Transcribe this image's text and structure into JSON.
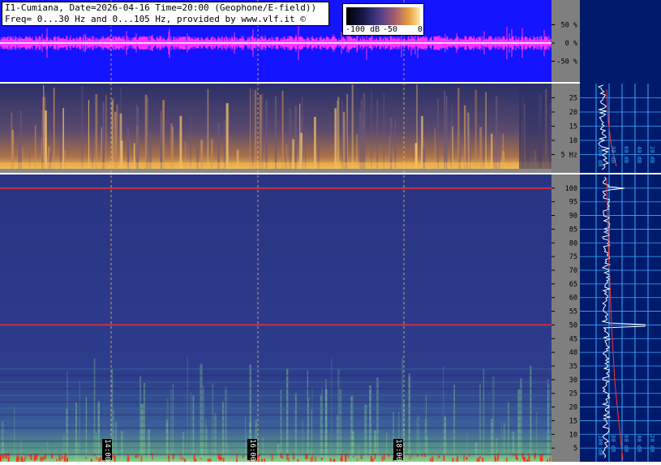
{
  "header": {
    "line1": "I1-Cumiana, Date=2026-04-16 Time=20:00 (Geophone/E-field))",
    "line2": "Freq= 0...30 Hz and 0...105 Hz, provided by www.vlf.it ©"
  },
  "colorbar": {
    "labels": [
      "-100 dB",
      "-50",
      "0"
    ],
    "colors": [
      "#000000",
      "#1a1a50",
      "#4a3f8a",
      "#a05a70",
      "#e9a040",
      "#ffe7a6"
    ]
  },
  "time_markers": [
    "14:00",
    "16:00",
    "18:00"
  ],
  "colors": {
    "waveform_bg": "#1414ff",
    "waveform_trace": "#ff33ff",
    "spec_low_bg": "#29306b",
    "spec_main_bg": "#2b3886",
    "axis_bg": "#7f7f7f",
    "side_bg": "#001a6c",
    "side_grid": "#3aa9ff",
    "power_line": "#ff2a2a",
    "trace_white": "#ffffff",
    "trace_red": "#ff3333"
  },
  "chart_data": [
    {
      "type": "line",
      "title": "",
      "description_key": "amplitude waveform",
      "ylabel_ticks": [
        "50 %",
        "0 %",
        "-50 %"
      ],
      "yticks": [
        50,
        0,
        -50
      ],
      "ylim": [
        -100,
        100
      ]
    },
    {
      "type": "heatmap",
      "ylabel_ticks": [
        "25",
        "20",
        "15",
        "10",
        "5 Hz"
      ],
      "yticks": [
        25,
        20,
        15,
        10,
        5
      ],
      "ylim": [
        0,
        30
      ],
      "x_ticks": [
        "14:00",
        "16:00",
        "18:00"
      ],
      "side_ticks": [
        "100 dB",
        "80 dB",
        "60 dB",
        "40 dB",
        "20 dB"
      ]
    },
    {
      "type": "heatmap",
      "ylabel_ticks": [
        "100",
        "95",
        "90",
        "85",
        "80",
        "75",
        "70",
        "65",
        "60",
        "55",
        "50",
        "45",
        "40",
        "35",
        "30",
        "25",
        "20",
        "15",
        "10",
        "5"
      ],
      "yticks": [
        100,
        95,
        90,
        85,
        80,
        75,
        70,
        65,
        60,
        55,
        50,
        45,
        40,
        35,
        30,
        25,
        20,
        15,
        10,
        5
      ],
      "ylim": [
        0,
        105
      ],
      "x_ticks": [
        "14:00",
        "16:00",
        "18:00"
      ],
      "lines_hz": [
        100,
        50
      ],
      "side_ticks": [
        "100 dB",
        "80 dB",
        "60 dB",
        "40 dB",
        "20 dB"
      ]
    }
  ]
}
